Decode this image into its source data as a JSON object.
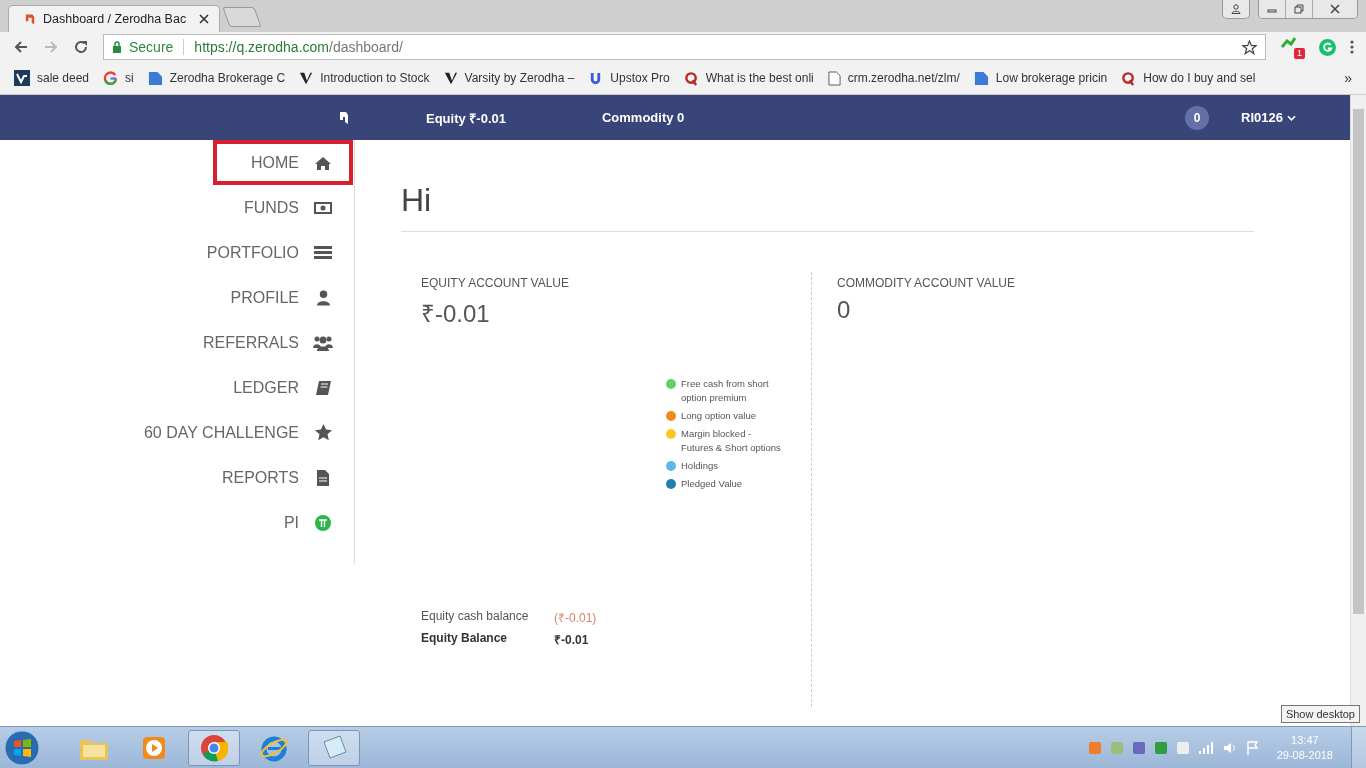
{
  "browser": {
    "tab": {
      "title": "Dashboard / Zerodha Bac"
    },
    "address": {
      "secure_label": "Secure",
      "url_host": "https://q.zerodha.com",
      "url_path": "/dashboard/"
    },
    "extension_badge": "1",
    "bookmarks": [
      {
        "kind": "zv",
        "label": "sale deed"
      },
      {
        "kind": "google",
        "label": "si"
      },
      {
        "kind": "doc",
        "label": "Zerodha Brokerage C"
      },
      {
        "kind": "v",
        "label": "Introduction to Stock"
      },
      {
        "kind": "v",
        "label": "Varsity by Zerodha –"
      },
      {
        "kind": "upstox",
        "label": "Upstox Pro"
      },
      {
        "kind": "q",
        "label": "What is the best onli"
      },
      {
        "kind": "page",
        "label": "crm.zerodha.net/zlm/"
      },
      {
        "kind": "doc",
        "label": "Low brokerage pricin"
      },
      {
        "kind": "q",
        "label": "How do I buy and sel"
      }
    ],
    "overflow": "»"
  },
  "topbar": {
    "equity": "Equity ₹-0.01",
    "commodity": "Commodity 0",
    "notifications": "0",
    "user": "RI0126"
  },
  "sidebar": {
    "items": [
      {
        "label": "HOME",
        "kind": "home",
        "selected": true
      },
      {
        "label": "FUNDS",
        "kind": "money",
        "selected": false
      },
      {
        "label": "PORTFOLIO",
        "kind": "list",
        "selected": false
      },
      {
        "label": "PROFILE",
        "kind": "user",
        "selected": false
      },
      {
        "label": "REFERRALS",
        "kind": "users",
        "selected": false
      },
      {
        "label": "LEDGER",
        "kind": "book",
        "selected": false
      },
      {
        "label": "60 DAY CHALLENGE",
        "kind": "star",
        "selected": false
      },
      {
        "label": "REPORTS",
        "kind": "file",
        "selected": false
      },
      {
        "label": "PI",
        "kind": "pi",
        "selected": false
      }
    ]
  },
  "greeting": "Hi",
  "equity": {
    "title": "EQUITY ACCOUNT VALUE",
    "value": "₹-0.01",
    "legend": [
      {
        "label": "Free cash from short option premium",
        "color": "#5fd16b"
      },
      {
        "label": "Long option value",
        "color": "#f0891e"
      },
      {
        "label": "Margin blocked - Futures & Short options",
        "color": "#f5cb2a"
      },
      {
        "label": "Holdings",
        "color": "#5bb8e8"
      },
      {
        "label": "Pledged Value",
        "color": "#1f7fb5"
      }
    ],
    "balances": [
      {
        "kind": "cash",
        "label": "Equity cash balance",
        "value": "(₹-0.01)"
      },
      {
        "kind": "total",
        "label": "Equity Balance",
        "value": "₹-0.01"
      }
    ]
  },
  "commodity": {
    "title": "COMMODITY ACCOUNT VALUE",
    "value": "0"
  },
  "taskbar": {
    "apps": [
      {
        "kind": "explorer",
        "running": false
      },
      {
        "kind": "media",
        "running": false
      },
      {
        "kind": "chrome",
        "running": true
      },
      {
        "kind": "ie",
        "running": false
      },
      {
        "kind": "notepad",
        "running": true
      }
    ],
    "time": "13:47",
    "date": "29-08-2018",
    "tooltip": "Show desktop"
  }
}
